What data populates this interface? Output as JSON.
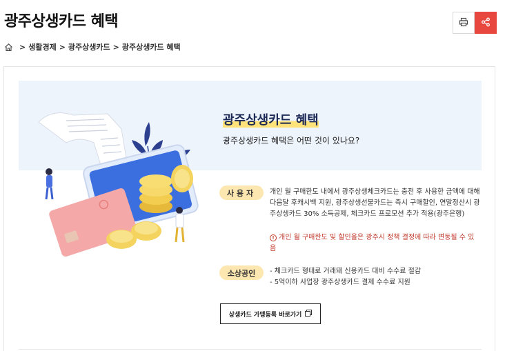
{
  "page": {
    "title": "광주상생카드 혜택"
  },
  "toolbar": {
    "print_icon": "printer-icon",
    "share_icon": "share-icon",
    "share_color": "#e8473f"
  },
  "breadcrumb": {
    "home_icon": "home-icon",
    "items": [
      "생활경제",
      "광주상생카드",
      "광주상생카드 혜택"
    ]
  },
  "hero": {
    "title": "광주상생카드 혜택",
    "subtitle": "광주상생카드 혜택은 어떤 것이 있나요?"
  },
  "benefits": {
    "user": {
      "badge": "사용자",
      "description": "개인 월 구매한도 내에서 광주상생체크카드는 충전 후 사용한 금액에 대해 다음달 후캐시백 지원, 광주상생선불카드는 즉시 구매할인, 연말정산시 광주상생카드 30% 소득공제, 체크카드 프로모션 추가 적용(광주은행)",
      "warning": "개인 월 구매한도 및 할인율은 광주시 정책 결정에 따라 변동될 수 있음"
    },
    "smb": {
      "badge": "소상공인",
      "items": [
        "체크카드 형태로 거래돼 신용카드 대비 수수료 절감",
        "5억이하 사업장 광주상생카드 결제 수수료 지원"
      ]
    }
  },
  "link_button": {
    "label": "상생카드 가맹등록 바로가기",
    "icon": "external-link-icon"
  },
  "colors": {
    "accent": "#e8473f",
    "badge_bg": "#fde7b0",
    "hero_bg": "#eef4fc",
    "title_navy": "#1d2a55",
    "warning": "#c0392b"
  }
}
